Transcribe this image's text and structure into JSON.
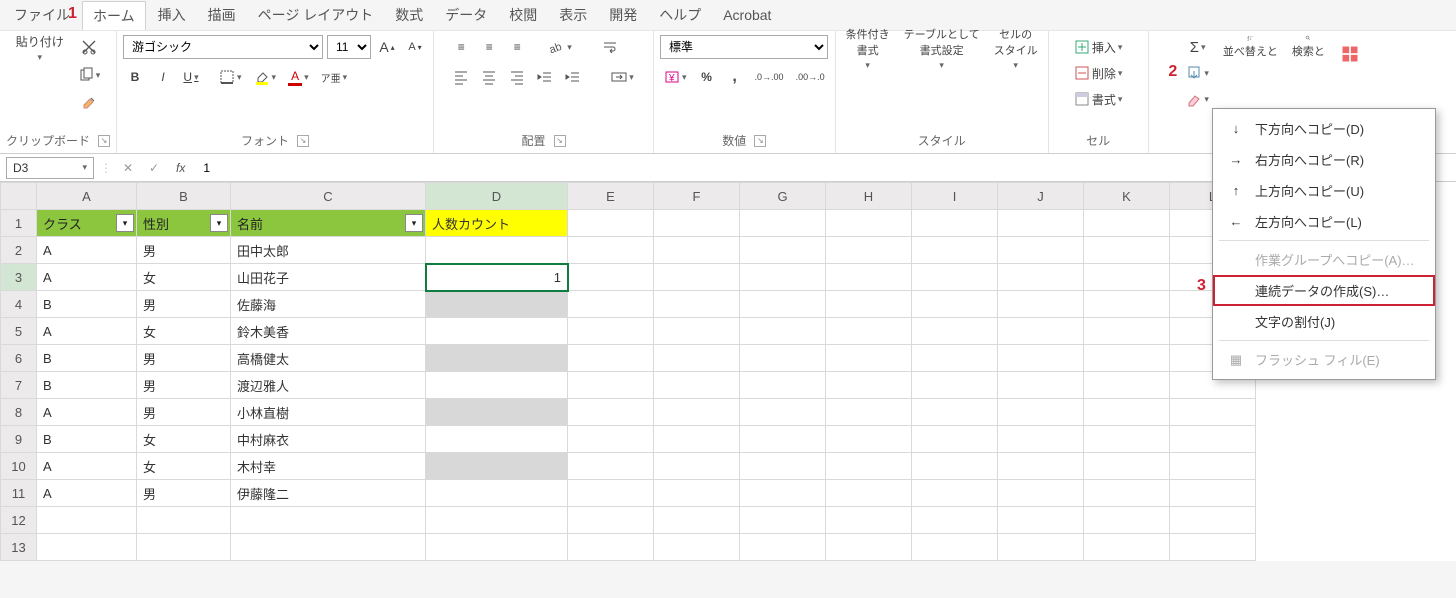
{
  "tabs": [
    "ファイル",
    "ホーム",
    "挿入",
    "描画",
    "ページ レイアウト",
    "数式",
    "データ",
    "校閲",
    "表示",
    "開発",
    "ヘルプ",
    "Acrobat"
  ],
  "active_tab": 1,
  "annotations": {
    "a1": "1",
    "a2": "2",
    "a3": "3"
  },
  "ribbon": {
    "clipboard": {
      "paste": "貼り付け",
      "label": "クリップボード"
    },
    "font": {
      "name": "游ゴシック",
      "size": "11",
      "label": "フォント"
    },
    "align": {
      "label": "配置"
    },
    "number": {
      "format": "標準",
      "label": "数値"
    },
    "styles": {
      "cond": "条件付き\n書式",
      "table": "テーブルとして\n書式設定",
      "cell": "セルの\nスタイル",
      "label": "スタイル"
    },
    "cells": {
      "insert": "挿入",
      "delete": "削除",
      "format": "書式",
      "label": "セル"
    },
    "editing": {
      "sort": "並べ替えと",
      "find": "検索と",
      "addin": "アド"
    }
  },
  "formula": {
    "name": "D3",
    "value": "1"
  },
  "columns": [
    "A",
    "B",
    "C",
    "D",
    "E",
    "F",
    "G",
    "H",
    "I",
    "J",
    "K",
    "L"
  ],
  "headers": {
    "A": "クラス",
    "B": "性別",
    "C": "名前",
    "D": "人数カウント"
  },
  "rows": [
    {
      "A": "A",
      "B": "男",
      "C": "田中太郎",
      "D": ""
    },
    {
      "A": "A",
      "B": "女",
      "C": "山田花子",
      "D": "1"
    },
    {
      "A": "B",
      "B": "男",
      "C": "佐藤海",
      "D": ""
    },
    {
      "A": "A",
      "B": "女",
      "C": "鈴木美香",
      "D": ""
    },
    {
      "A": "B",
      "B": "男",
      "C": "高橋健太",
      "D": ""
    },
    {
      "A": "B",
      "B": "男",
      "C": "渡辺雅人",
      "D": ""
    },
    {
      "A": "A",
      "B": "男",
      "C": "小林直樹",
      "D": ""
    },
    {
      "A": "B",
      "B": "女",
      "C": "中村麻衣",
      "D": ""
    },
    {
      "A": "A",
      "B": "女",
      "C": "木村幸",
      "D": ""
    },
    {
      "A": "A",
      "B": "男",
      "C": "伊藤隆二",
      "D": ""
    },
    {
      "A": "",
      "B": "",
      "C": "",
      "D": ""
    },
    {
      "A": "",
      "B": "",
      "C": "",
      "D": ""
    }
  ],
  "greyed_d_rows": [
    4,
    6,
    8,
    10
  ],
  "ctx": {
    "down": "下方向へコピー(D)",
    "right": "右方向へコピー(R)",
    "up": "上方向へコピー(U)",
    "left": "左方向へコピー(L)",
    "group": "作業グループへコピー(A)…",
    "series": "連続データの作成(S)…",
    "justify": "文字の割付(J)",
    "flash": "フラッシュ フィル(E)"
  }
}
